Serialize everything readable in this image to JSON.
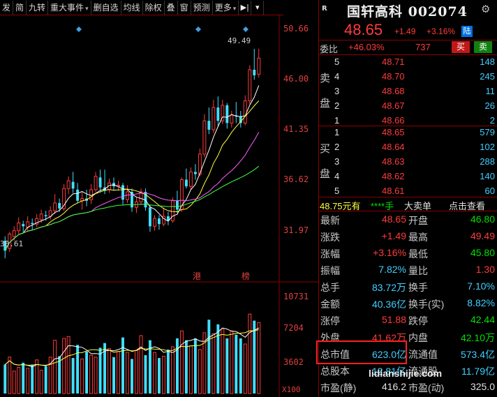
{
  "toolbar": {
    "items": [
      "发",
      "简",
      "九转",
      "重大事件",
      "删自选",
      "均线",
      "除权",
      "叠",
      "窗",
      "预测",
      "更多"
    ]
  },
  "chart": {
    "price_axis": [
      "50.66",
      "46.00",
      "41.35",
      "36.62",
      "31.97"
    ],
    "volume_axis": [
      "10731",
      "7204",
      "3602"
    ],
    "volume_unit": "X100",
    "high_marker": "49.49",
    "low_marker": "30.61",
    "tag_hk": "港",
    "tag_list": "榜",
    "colors": {
      "up": "#ff3b3b",
      "down": "#40e0ff",
      "ma5": "#ffffff",
      "ma10": "#ffff40",
      "ma20": "#ff60ff",
      "ma60": "#40ff40"
    }
  },
  "chart_data": {
    "type": "candlestick",
    "title": "",
    "candles": [
      {
        "o": 32.2,
        "c": 31.3,
        "h": 32.6,
        "l": 30.61
      },
      {
        "o": 31.5,
        "c": 32.8,
        "h": 33.0,
        "l": 31.2
      },
      {
        "o": 32.6,
        "c": 33.1,
        "h": 33.5,
        "l": 32.2
      },
      {
        "o": 33.1,
        "c": 33.8,
        "h": 34.3,
        "l": 32.8
      },
      {
        "o": 33.7,
        "c": 33.5,
        "h": 34.0,
        "l": 33.0
      },
      {
        "o": 33.4,
        "c": 33.9,
        "h": 34.4,
        "l": 33.0
      },
      {
        "o": 33.8,
        "c": 33.7,
        "h": 34.2,
        "l": 33.2
      },
      {
        "o": 33.7,
        "c": 34.2,
        "h": 34.6,
        "l": 33.4
      },
      {
        "o": 34.1,
        "c": 34.6,
        "h": 35.0,
        "l": 33.8
      },
      {
        "o": 34.5,
        "c": 34.4,
        "h": 34.9,
        "l": 34.0
      },
      {
        "o": 34.4,
        "c": 34.9,
        "h": 35.3,
        "l": 34.1
      },
      {
        "o": 34.9,
        "c": 35.6,
        "h": 36.4,
        "l": 34.6
      },
      {
        "o": 35.6,
        "c": 35.1,
        "h": 36.0,
        "l": 34.8
      },
      {
        "o": 35.1,
        "c": 36.9,
        "h": 37.3,
        "l": 34.9
      },
      {
        "o": 36.9,
        "c": 37.6,
        "h": 38.0,
        "l": 36.4
      },
      {
        "o": 37.5,
        "c": 36.9,
        "h": 38.4,
        "l": 36.5
      },
      {
        "o": 36.8,
        "c": 35.8,
        "h": 37.4,
        "l": 35.6
      },
      {
        "o": 35.8,
        "c": 36.0,
        "h": 36.6,
        "l": 35.0
      },
      {
        "o": 36.0,
        "c": 35.8,
        "h": 36.8,
        "l": 35.3
      },
      {
        "o": 35.9,
        "c": 36.8,
        "h": 37.3,
        "l": 35.5
      },
      {
        "o": 36.8,
        "c": 38.0,
        "h": 38.4,
        "l": 36.6
      },
      {
        "o": 37.9,
        "c": 37.0,
        "h": 38.6,
        "l": 36.6
      },
      {
        "o": 37.0,
        "c": 36.7,
        "h": 38.6,
        "l": 36.4
      },
      {
        "o": 36.8,
        "c": 37.4,
        "h": 37.8,
        "l": 36.5
      },
      {
        "o": 37.4,
        "c": 37.1,
        "h": 37.9,
        "l": 36.7
      },
      {
        "o": 37.1,
        "c": 37.2,
        "h": 37.6,
        "l": 36.7
      },
      {
        "o": 37.2,
        "c": 35.9,
        "h": 37.4,
        "l": 35.4
      },
      {
        "o": 35.9,
        "c": 36.6,
        "h": 37.2,
        "l": 35.6
      },
      {
        "o": 36.6,
        "c": 35.2,
        "h": 36.9,
        "l": 34.8
      },
      {
        "o": 35.2,
        "c": 35.7,
        "h": 36.1,
        "l": 34.7
      },
      {
        "o": 35.7,
        "c": 36.6,
        "h": 36.9,
        "l": 35.4
      },
      {
        "o": 36.6,
        "c": 35.2,
        "h": 36.9,
        "l": 34.9
      },
      {
        "o": 35.2,
        "c": 33.5,
        "h": 35.4,
        "l": 33.0
      },
      {
        "o": 33.5,
        "c": 34.2,
        "h": 34.5,
        "l": 33.1
      },
      {
        "o": 34.2,
        "c": 33.7,
        "h": 34.5,
        "l": 33.2
      },
      {
        "o": 33.7,
        "c": 34.4,
        "h": 35.2,
        "l": 33.5
      },
      {
        "o": 34.4,
        "c": 34.0,
        "h": 34.8,
        "l": 33.6
      },
      {
        "o": 34.0,
        "c": 35.8,
        "h": 36.1,
        "l": 33.8
      },
      {
        "o": 35.8,
        "c": 35.0,
        "h": 36.7,
        "l": 34.7
      },
      {
        "o": 35.0,
        "c": 37.7,
        "h": 37.9,
        "l": 34.8
      },
      {
        "o": 37.7,
        "c": 37.1,
        "h": 38.7,
        "l": 36.9
      },
      {
        "o": 37.1,
        "c": 38.4,
        "h": 38.8,
        "l": 36.8
      },
      {
        "o": 38.4,
        "c": 38.2,
        "h": 39.1,
        "l": 37.7
      },
      {
        "o": 38.2,
        "c": 40.0,
        "h": 40.5,
        "l": 38.0
      },
      {
        "o": 40.0,
        "c": 43.0,
        "h": 43.6,
        "l": 39.7
      },
      {
        "o": 43.0,
        "c": 42.2,
        "h": 44.2,
        "l": 41.8
      },
      {
        "o": 42.2,
        "c": 44.2,
        "h": 44.9,
        "l": 41.9
      },
      {
        "o": 44.2,
        "c": 43.0,
        "h": 45.2,
        "l": 42.5
      },
      {
        "o": 43.0,
        "c": 44.4,
        "h": 44.9,
        "l": 42.7
      },
      {
        "o": 44.4,
        "c": 42.8,
        "h": 44.6,
        "l": 42.3
      },
      {
        "o": 42.8,
        "c": 43.5,
        "h": 43.9,
        "l": 42.4
      },
      {
        "o": 43.5,
        "c": 43.4,
        "h": 44.7,
        "l": 42.8
      },
      {
        "o": 43.4,
        "c": 42.8,
        "h": 43.9,
        "l": 42.4
      },
      {
        "o": 42.8,
        "c": 44.8,
        "h": 45.3,
        "l": 42.6
      },
      {
        "o": 44.8,
        "c": 47.6,
        "h": 48.0,
        "l": 44.5
      },
      {
        "o": 47.6,
        "c": 47.1,
        "h": 49.49,
        "l": 46.7
      },
      {
        "o": 47.2,
        "c": 48.65,
        "h": 49.49,
        "l": 46.9
      }
    ],
    "volume": [
      3100,
      3900,
      2400,
      2800,
      3300,
      2700,
      3100,
      3600,
      2500,
      2900,
      3900,
      5700,
      4000,
      5900,
      6100,
      3800,
      5200,
      3700,
      4500,
      4100,
      3900,
      4900,
      5400,
      4800,
      3900,
      4500,
      6000,
      4400,
      3700,
      4600,
      6200,
      4100,
      5700,
      4400,
      3800,
      4000,
      4700,
      5000,
      5900,
      6700,
      5700,
      5100,
      5900,
      4700,
      6500,
      7900,
      6400,
      7400,
      6900,
      5900,
      6700,
      6300,
      5900,
      5300,
      8500,
      7800,
      7600
    ],
    "price_range": [
      30.0,
      52.0
    ],
    "volume_range": [
      0,
      11200
    ]
  },
  "panel": {
    "marker": "R",
    "name": "国轩高科 002074",
    "price": "48.65",
    "change": "+1.49",
    "change_pct": "+3.16%",
    "badge": "陆",
    "weibi_label": "委比",
    "weibi_pct": "+46.03%",
    "weibi_diff": "737",
    "buy_btn": "买",
    "sell_btn": "卖",
    "sell_side_chars": [
      "卖",
      "盘"
    ],
    "buy_side_chars": [
      "买",
      "盘"
    ],
    "asks": [
      {
        "lvl": "5",
        "price": "48.71",
        "vol": "148"
      },
      {
        "lvl": "4",
        "price": "48.70",
        "vol": "245"
      },
      {
        "lvl": "3",
        "price": "48.68",
        "vol": "11"
      },
      {
        "lvl": "2",
        "price": "48.67",
        "vol": "26"
      },
      {
        "lvl": "1",
        "price": "48.66",
        "vol": "2"
      }
    ],
    "bids": [
      {
        "lvl": "1",
        "price": "48.65",
        "vol": "579"
      },
      {
        "lvl": "2",
        "price": "48.64",
        "vol": "102"
      },
      {
        "lvl": "3",
        "price": "48.63",
        "vol": "288"
      },
      {
        "lvl": "4",
        "price": "48.62",
        "vol": "140"
      },
      {
        "lvl": "5",
        "price": "48.61",
        "vol": "60"
      }
    ],
    "bigorder": {
      "amount": "48.75元有",
      "mask": "****手",
      "label": "大卖单",
      "link": "点击查看"
    },
    "stats": [
      {
        "l1": "最新",
        "v1": "48.65",
        "c1": "red",
        "l2": "开盘",
        "v2": "46.80",
        "c2": "grn"
      },
      {
        "l1": "涨跌",
        "v1": "+1.49",
        "c1": "red",
        "l2": "最高",
        "v2": "49.49",
        "c2": "red"
      },
      {
        "l1": "涨幅",
        "v1": "+3.16%",
        "c1": "red",
        "l2": "最低",
        "v2": "45.80",
        "c2": "grn"
      },
      {
        "l1": "振幅",
        "v1": "7.82%",
        "c1": "cyan",
        "l2": "量比",
        "v2": "1.30",
        "c2": "red"
      },
      {
        "l1": "总手",
        "v1": "83.72万",
        "c1": "cyan",
        "l2": "换手",
        "v2": "7.10%",
        "c2": "cyan"
      },
      {
        "l1": "金额",
        "v1": "40.36亿",
        "c1": "cyan",
        "l2": "换手(实)",
        "v2": "8.82%",
        "c2": "cyan"
      },
      {
        "l1": "涨停",
        "v1": "51.88",
        "c1": "red",
        "l2": "跌停",
        "v2": "42.44",
        "c2": "grn"
      },
      {
        "l1": "外盘",
        "v1": "41.62万",
        "c1": "red",
        "l2": "内盘",
        "v2": "42.10万",
        "c2": "grn"
      },
      {
        "l1": "总市值",
        "v1": "623.0亿",
        "c1": "cyan",
        "l2": "流通值",
        "v2": "573.4亿",
        "c2": "cyan"
      },
      {
        "l1": "总股本",
        "v1": "12.81亿",
        "c1": "cyan",
        "l2": "流通股",
        "v2": "11.79亿",
        "c2": "cyan"
      },
      {
        "l1": "市盈(静)",
        "v1": "416.2",
        "c1": "wht",
        "l2": "市盈(动)",
        "v2": "325.0",
        "c2": "wht"
      }
    ]
  },
  "watermark": "lidianshijie.com"
}
